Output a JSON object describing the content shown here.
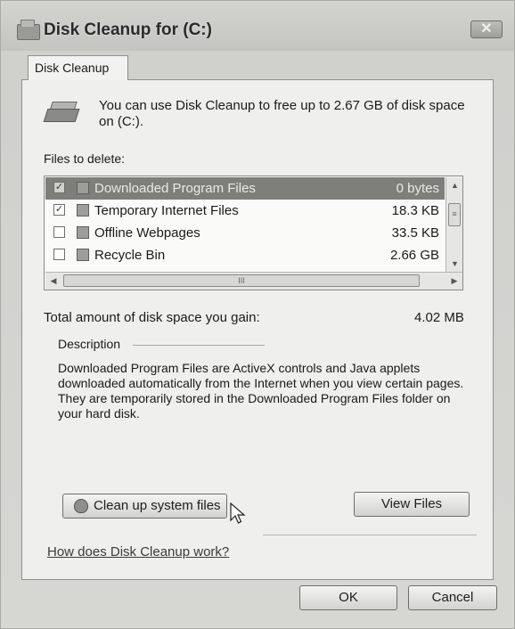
{
  "window": {
    "title": "Disk Cleanup for  (C:)",
    "close_glyph": "✕"
  },
  "tabs": [
    {
      "label": "Disk Cleanup"
    }
  ],
  "intro": "You can use Disk Cleanup to free up to 2.67 GB of disk space on  (C:).",
  "files_label": "Files to delete:",
  "files": [
    {
      "name": "Downloaded Program Files",
      "size": "0 bytes",
      "checked": true,
      "selected": true,
      "icon": "folder-icon"
    },
    {
      "name": "Temporary Internet Files",
      "size": "18.3 KB",
      "checked": true,
      "selected": false,
      "icon": "page-icon"
    },
    {
      "name": "Offline Webpages",
      "size": "33.5 KB",
      "checked": false,
      "selected": false,
      "icon": "globe-icon"
    },
    {
      "name": "Recycle Bin",
      "size": "2.66 GB",
      "checked": false,
      "selected": false,
      "icon": "recycle-bin-icon"
    }
  ],
  "total_label": "Total amount of disk space you gain:",
  "total_value": "4.02 MB",
  "description_label": "Description",
  "description_text": "Downloaded Program Files are ActiveX controls and Java applets downloaded automatically from the Internet when you view certain pages. They are temporarily stored in the Downloaded Program Files folder on your hard disk.",
  "buttons": {
    "cleanup_system": "Clean up system files",
    "view_files": "View Files",
    "ok": "OK",
    "cancel": "Cancel"
  },
  "help_link": "How does Disk Cleanup work?",
  "scroll": {
    "grip": "III",
    "grip_v": "≡"
  }
}
